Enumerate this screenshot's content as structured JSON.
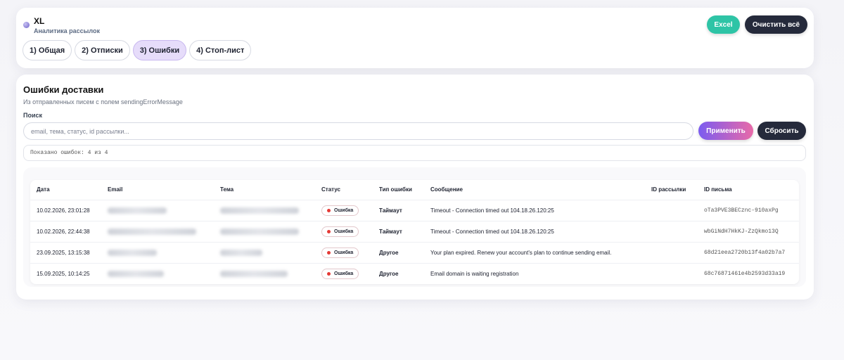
{
  "app": {
    "name": "XL",
    "subtitle": "Аналитика рассылок"
  },
  "tabs": [
    {
      "label": "1) Общая",
      "active": false
    },
    {
      "label": "2) Отписки",
      "active": false
    },
    {
      "label": "3) Ошибки",
      "active": true
    },
    {
      "label": "4) Стоп-лист",
      "active": false
    }
  ],
  "actions": {
    "excel_label": "Excel",
    "clear_label": "Очистить всё"
  },
  "section": {
    "title": "Ошибки доставки",
    "subtitle": "Из отправленных писем с полем sendingErrorMessage"
  },
  "search": {
    "label": "Поиск",
    "value": "",
    "placeholder": "email, тема, статус, id рассылки...",
    "apply_label": "Применить",
    "reset_label": "Сбросить"
  },
  "counter": "Показано ошибок: 4 из 4",
  "table": {
    "columns": [
      "Дата",
      "Email",
      "Тема",
      "Статус",
      "Тип ошибки",
      "Сообщение",
      "ID рассылки",
      "ID письма"
    ],
    "rows": [
      {
        "date": "10.02.2026, 23:01:28",
        "status": "Ошибка",
        "type": "Таймаут",
        "message": "Timeout - Connection timed out 104.18.26.120:25",
        "campaign_id": "",
        "message_id": "oTa3PVE3BECznc-910axPg"
      },
      {
        "date": "10.02.2026, 22:44:38",
        "status": "Ошибка",
        "type": "Таймаут",
        "message": "Timeout - Connection timed out 104.18.26.120:25",
        "campaign_id": "",
        "message_id": "wbGiNdH7HkKJ-ZzQkmo13Q"
      },
      {
        "date": "23.09.2025, 13:15:38",
        "status": "Ошибка",
        "type": "Другое",
        "message": "Your plan expired. Renew your account's plan to continue sending email.",
        "campaign_id": "",
        "message_id": "68d21eea2720b13f4a02b7a7"
      },
      {
        "date": "15.09.2025, 10:14:25",
        "status": "Ошибка",
        "type": "Другое",
        "message": "Email domain is waiting registration",
        "campaign_id": "",
        "message_id": "68c76871461e4b2593d33a19"
      }
    ]
  },
  "colors": {
    "accent_teal": "#2ec4a6",
    "dark_button": "#252a3b",
    "active_tab": "#e6dcfa",
    "error_dot": "#e53935"
  }
}
